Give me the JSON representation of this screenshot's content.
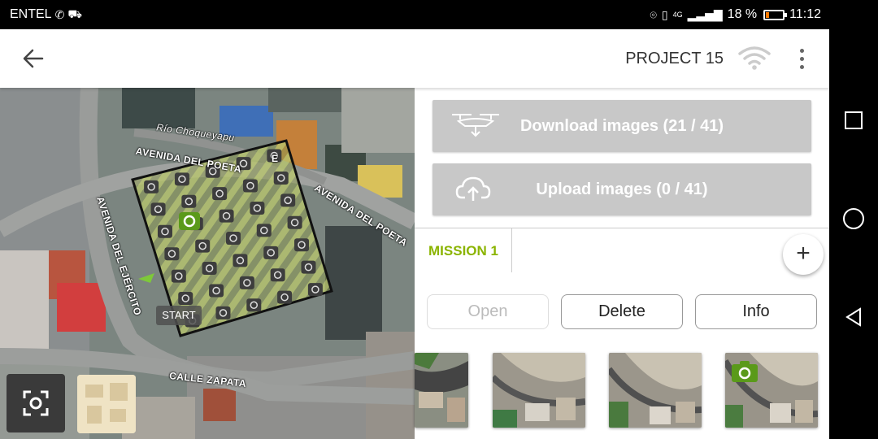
{
  "status_bar": {
    "carrier": "ENTEL",
    "network": "4G",
    "battery_percent": "18 %",
    "battery_level": 0.18,
    "time": "11:12",
    "icons": [
      "whatsapp-icon",
      "game-icon",
      "location-icon",
      "vibrate-icon",
      "signal-icon",
      "battery-icon"
    ]
  },
  "toolbar": {
    "back_icon": "arrow-left-icon",
    "title": "PROJECT 15",
    "wifi_icon": "wifi-icon",
    "menu_icon": "more-vert-icon"
  },
  "map": {
    "labels": {
      "street1": "Río Choqueyapu",
      "street2": "AVENIDA DEL POETA",
      "street3": "AVENIDA DEL POETA",
      "street4": "AVENIDA DEL EJÉRCITO",
      "street5": "CALLE ZAPATA",
      "end": "E",
      "start": "START"
    },
    "center_icon": "focus-center-icon",
    "thumbnail_icon": "map-layer-thumbnail"
  },
  "panel": {
    "download": {
      "label": "Download images (21 / 41)",
      "icon": "drone-download-icon"
    },
    "upload": {
      "label": "Upload images (0 / 41)",
      "icon": "cloud-upload-icon"
    },
    "mission_tab": "MISSION 1",
    "add_label": "+",
    "actions": {
      "open": "Open",
      "delete": "Delete",
      "info": "Info"
    },
    "photos": [
      "photo-1",
      "photo-2",
      "photo-3",
      "photo-4"
    ],
    "photo_camera_icon": "camera-icon"
  },
  "colors": {
    "accent": "#8bb400",
    "button_gray": "#c8c8c8",
    "camera_green": "#5a9a1a"
  },
  "nav_bar": {
    "icons": [
      "recent-apps-icon",
      "home-icon",
      "back-icon"
    ]
  }
}
